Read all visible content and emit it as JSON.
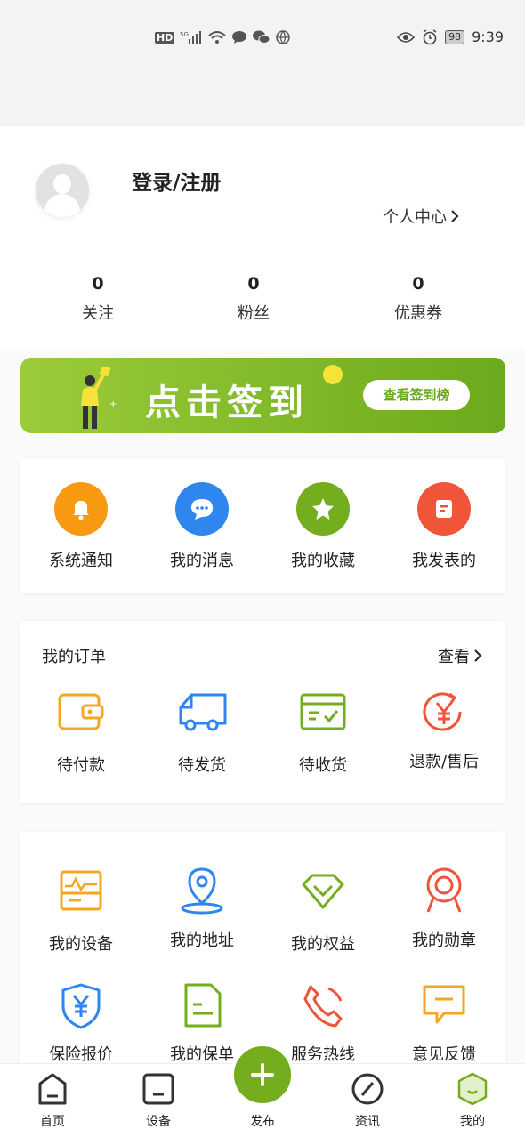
{
  "status_bar": {
    "left_icons": [
      "hd-icon",
      "5g-signal-icon",
      "wifi-icon",
      "message-icon",
      "wechat-icon",
      "browser-icon"
    ],
    "hd": "HD",
    "battery": "98",
    "time": "9:39"
  },
  "profile": {
    "login": "登录/注册",
    "center_link": "个人中心"
  },
  "stats": [
    {
      "value": "0",
      "label": "关注"
    },
    {
      "value": "0",
      "label": "粉丝"
    },
    {
      "value": "0",
      "label": "优惠券"
    }
  ],
  "banner": {
    "title": "点击签到",
    "button": "查看签到榜",
    "colors": [
      "#9ccb3a",
      "#6aaa1c"
    ]
  },
  "quick": [
    {
      "label": "系统通知",
      "icon": "bell-icon",
      "color": "#f79a12"
    },
    {
      "label": "我的消息",
      "icon": "chat-icon",
      "color": "#2f86ee"
    },
    {
      "label": "我的收藏",
      "icon": "star-icon",
      "color": "#74ad1e"
    },
    {
      "label": "我发表的",
      "icon": "post-icon",
      "color": "#f0553a"
    }
  ],
  "orders": {
    "title": "我的订单",
    "link": "查看",
    "items": [
      {
        "label": "待付款",
        "icon": "wallet-icon",
        "color": "#f5a623"
      },
      {
        "label": "待发货",
        "icon": "truck-icon",
        "color": "#2f86ee"
      },
      {
        "label": "待收货",
        "icon": "box-icon",
        "color": "#74ad1e"
      },
      {
        "label": "退款/售后",
        "icon": "refund-icon",
        "color": "#f0553a"
      }
    ]
  },
  "services": [
    {
      "label": "我的设备",
      "icon": "device-icon",
      "color": "#f5a623"
    },
    {
      "label": "我的地址",
      "icon": "location-icon",
      "color": "#2f86ee"
    },
    {
      "label": "我的权益",
      "icon": "diamond-icon",
      "color": "#74ad1e"
    },
    {
      "label": "我的勋章",
      "icon": "medal-icon",
      "color": "#f0553a"
    },
    {
      "label": "保险报价",
      "icon": "shield-yen-icon",
      "color": "#2f86ee"
    },
    {
      "label": "我的保单",
      "icon": "document-icon",
      "color": "#74ad1e"
    },
    {
      "label": "服务热线",
      "icon": "phone-icon",
      "color": "#f0553a"
    },
    {
      "label": "意见反馈",
      "icon": "feedback-icon",
      "color": "#f5a623"
    }
  ],
  "tabbar": {
    "tabs": [
      {
        "label": "首页",
        "icon": "home-icon"
      },
      {
        "label": "设备",
        "icon": "device-tab-icon"
      },
      {
        "label": "发布",
        "icon": "plus-icon"
      },
      {
        "label": "资讯",
        "icon": "compass-icon"
      },
      {
        "label": "我的",
        "icon": "profile-tab-icon"
      }
    ],
    "accent": "#74ad1e"
  }
}
